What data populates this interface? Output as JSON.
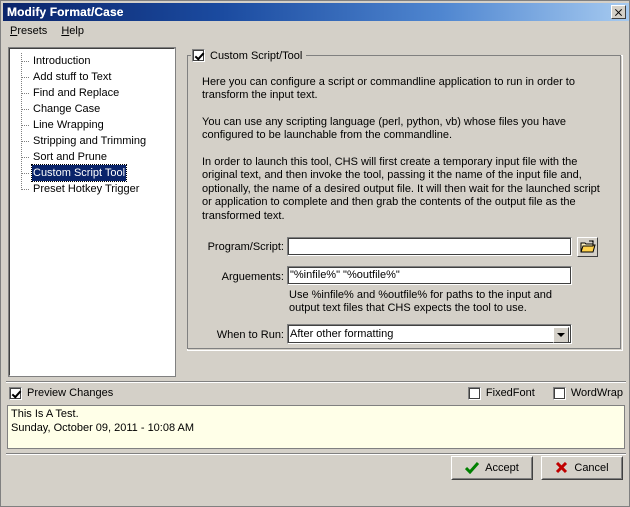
{
  "window": {
    "title": "Modify Format/Case",
    "close_label": "×"
  },
  "menu": {
    "items": [
      {
        "label": "Presets",
        "accel": "P"
      },
      {
        "label": "Help",
        "accel": "H"
      }
    ]
  },
  "tree": {
    "items": [
      {
        "label": "Introduction",
        "selected": false
      },
      {
        "label": "Add stuff to Text",
        "selected": false
      },
      {
        "label": "Find and Replace",
        "selected": false
      },
      {
        "label": "Change Case",
        "selected": false
      },
      {
        "label": "Line Wrapping",
        "selected": false
      },
      {
        "label": "Stripping and Trimming",
        "selected": false
      },
      {
        "label": "Sort and Prune",
        "selected": false
      },
      {
        "label": "Custom Script Tool",
        "selected": true
      },
      {
        "label": "Preset Hotkey Trigger",
        "selected": false
      }
    ]
  },
  "groupbox": {
    "legend": "Custom Script/Tool",
    "checked": true,
    "paragraphs": [
      "Here you can configure a script or commandline application to run in order to transform the input text.",
      "You can use any scripting language (perl, python, vb) whose files you have configured to be launchable from the commandline.",
      "In order to launch this tool, CHS will first create a temporary input file with the original text, and then invoke the tool, passing it the name of the input file and, optionally, the name of a desired output file.  It will then wait for the launched script or application to complete and then grab the contents of the output file as the transformed text."
    ]
  },
  "form": {
    "program_label": "Program/Script:",
    "program_value": "",
    "program_placeholder": "",
    "browse_icon": "open-folder-icon",
    "arguments_label": "Arguements:",
    "arguments_value": "\"%infile%\" \"%outfile%\"",
    "hint": "Use %infile% and %outfile% for paths to the input and output text files that CHS expects the tool to use.",
    "when_label": "When to Run:",
    "when_value": "After other formatting",
    "when_options": [
      "After other formatting"
    ]
  },
  "options": {
    "preview_changes": {
      "label": "Preview Changes",
      "checked": true
    },
    "fixed_font": {
      "label": "FixedFont",
      "checked": false
    },
    "word_wrap": {
      "label": "WordWrap",
      "checked": false
    }
  },
  "preview": {
    "line1": "This Is A Test.",
    "line2": "Sunday, October 09, 2011 - 10:08 AM"
  },
  "buttons": {
    "accept": {
      "label": "Accept",
      "icon": "check-icon",
      "color": "#008000"
    },
    "cancel": {
      "label": "Cancel",
      "icon": "x-icon",
      "color": "#c00000"
    }
  },
  "colors": {
    "face": "#d4d0c8",
    "title_left": "#0a246a",
    "title_right": "#a6caf0",
    "selection": "#0a246a",
    "preview_bg": "#ffffe8"
  }
}
